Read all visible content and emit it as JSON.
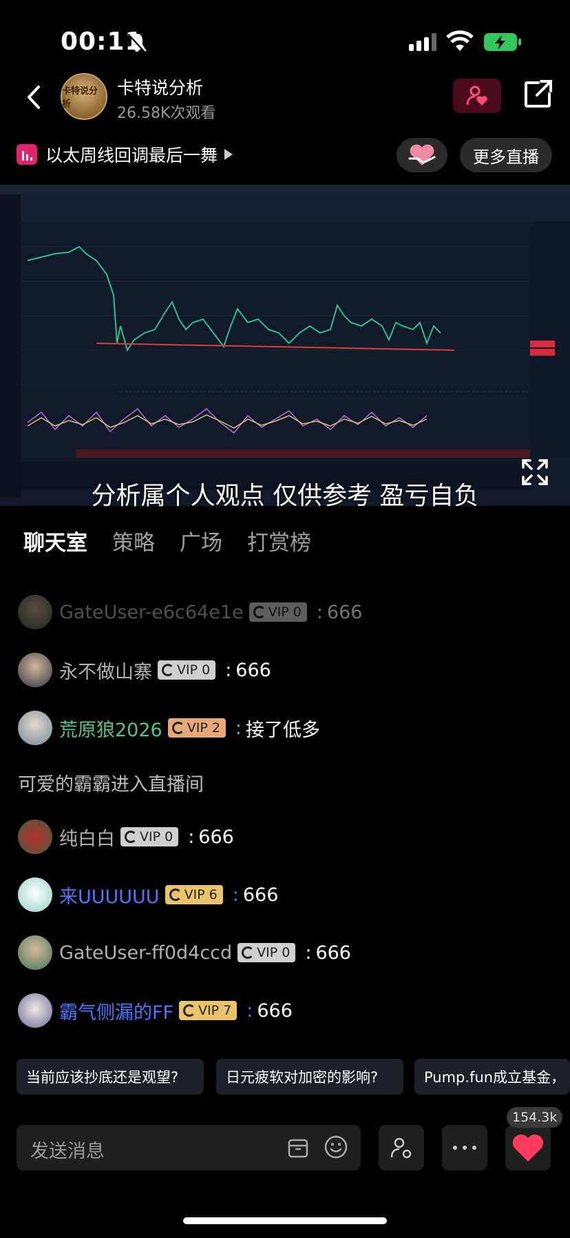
{
  "status": {
    "time": "00:11"
  },
  "header": {
    "host_name": "卡特说分析",
    "views": "26.58K次观看",
    "avatar_text": "卡特说分析"
  },
  "topic": {
    "title": "以太周线回调最后一舞",
    "more_live": "更多直播"
  },
  "video": {
    "subtitle": "分析属个人观点 仅供参考 盈亏自负"
  },
  "tabs": [
    "聊天室",
    "策略",
    "广场",
    "打赏榜"
  ],
  "chat": [
    {
      "name": "GateUser-e6c64e1e",
      "vip": "VIP 0",
      "text": "666",
      "name_color": "#b0b0b0",
      "vip_style": "gray",
      "faded": true
    },
    {
      "name": "永不做山寨",
      "vip": "VIP 0",
      "text": "666",
      "name_color": "#b0b0b0",
      "vip_style": "gray"
    },
    {
      "name": "荒原狼2026",
      "vip": "VIP 2",
      "text": "接了低多",
      "name_color": "#4fc88a",
      "vip_style": "orange"
    },
    {
      "system": "可爱的霸霸进入直播间"
    },
    {
      "name": "纯白白",
      "vip": "VIP 0",
      "text": "666",
      "name_color": "#b0b0b0",
      "vip_style": "gray"
    },
    {
      "name": "来UUUUUU",
      "vip": "VIP 6",
      "text": "666",
      "name_color": "#4a78ff",
      "vip_style": "gold"
    },
    {
      "name": "GateUser-ff0d4ccd",
      "vip": "VIP 0",
      "text": "666",
      "name_color": "#b0b0b0",
      "vip_style": "gray"
    },
    {
      "name": "霸气侧漏的FF",
      "vip": "VIP 7",
      "text": "666",
      "name_color": "#4a78ff",
      "vip_style": "gold"
    }
  ],
  "suggestions": [
    "当前应该抄底还是观望?",
    "日元疲软对加密的影响?",
    "Pump.fun成立基金，"
  ],
  "bottom": {
    "placeholder": "发送消息",
    "like_count": "154.3k"
  },
  "colors": {
    "accent_pink": "#e0246c",
    "like_red": "#ff3b5c"
  }
}
